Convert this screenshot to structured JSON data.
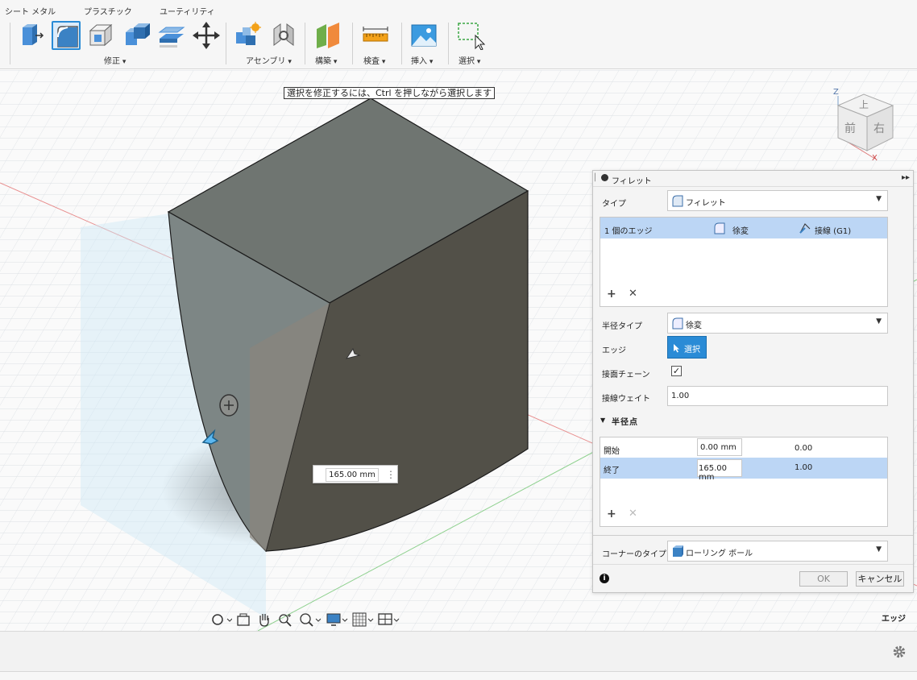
{
  "ribbon": {
    "tabs": [
      "シート メタル",
      "プラスチック",
      "ユーティリティ"
    ],
    "groups": [
      "修正",
      "アセンブリ",
      "構築",
      "検査",
      "挿入",
      "選択"
    ]
  },
  "viewport": {
    "hint": "選択を修正するには、Ctrl を押しながら選択します",
    "dimension_value": "165.00 mm",
    "view_cube": {
      "top": "上",
      "front": "前",
      "right": "右",
      "z": "Z",
      "x": "X"
    },
    "status": "エッジ"
  },
  "panel": {
    "title": "フィレット",
    "type_label": "タイプ",
    "type_value": "フィレット",
    "edge_count": "1 個のエッジ",
    "edge_radius_type": "徐変",
    "edge_continuity": "接線 (G1)",
    "radius_type_label": "半径タイプ",
    "radius_type_value": "徐変",
    "edge_label": "エッジ",
    "select_button": "選択",
    "tangent_chain_label": "接面チェーン",
    "tangent_chain_checked": true,
    "tangent_weight_label": "接線ウェイト",
    "tangent_weight_value": "1.00",
    "radius_points_label": "半径点",
    "points": [
      {
        "name": "開始",
        "value": "0.00 mm",
        "pos": "0.00"
      },
      {
        "name": "終了",
        "value": "165.00 mm",
        "pos": "1.00"
      }
    ],
    "corner_type_label": "コーナーのタイプ",
    "corner_type_value": "ローリング ボール",
    "ok": "OK",
    "cancel": "キャンセル"
  }
}
